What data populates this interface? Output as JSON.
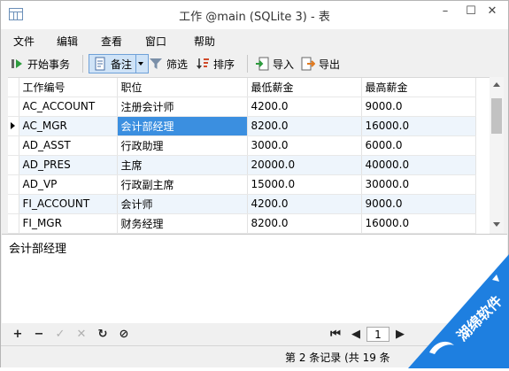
{
  "window": {
    "title": "工作 @main (SQLite 3) - 表"
  },
  "menu": [
    "文件",
    "编辑",
    "查看",
    "窗口",
    "帮助"
  ],
  "toolbar": {
    "begin_transaction": "开始事务",
    "note": "备注",
    "filter": "筛选",
    "sort": "排序",
    "import": "导入",
    "export": "导出"
  },
  "grid": {
    "columns": [
      "工作编号",
      "职位",
      "最低薪金",
      "最高薪金"
    ],
    "rows": [
      [
        "AC_ACCOUNT",
        "注册会计师",
        "4200.0",
        "9000.0"
      ],
      [
        "AC_MGR",
        "会计部经理",
        "8200.0",
        "16000.0"
      ],
      [
        "AD_ASST",
        "行政助理",
        "3000.0",
        "6000.0"
      ],
      [
        "AD_PRES",
        "主席",
        "20000.0",
        "40000.0"
      ],
      [
        "AD_VP",
        "行政副主席",
        "15000.0",
        "30000.0"
      ],
      [
        "FI_ACCOUNT",
        "会计师",
        "4200.0",
        "9000.0"
      ],
      [
        "FI_MGR",
        "财务经理",
        "8200.0",
        "16000.0"
      ]
    ],
    "current_row": 1,
    "selected_cell": [
      1,
      1
    ]
  },
  "detail": {
    "text": "会计部经理"
  },
  "navigation": {
    "page": "1"
  },
  "status": {
    "text": "第 2 条记录 (共 19 条"
  },
  "watermark": {
    "text": "湖绵软件"
  },
  "colors": {
    "selection": "#3b8fe0",
    "alt_row": "#eef5fc",
    "watermark": "#1e7fe0"
  }
}
